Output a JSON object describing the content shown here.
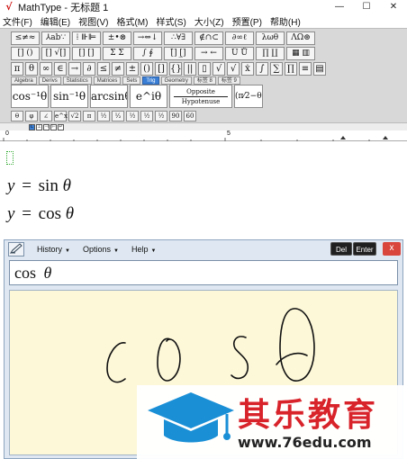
{
  "window": {
    "title": "MathType - 无标题 1",
    "logo_letter": "√",
    "min_glyph": "—",
    "max_glyph": "☐",
    "close_glyph": "✕"
  },
  "menubar": [
    "文件(F)",
    "编辑(E)",
    "视图(V)",
    "格式(M)",
    "样式(S)",
    "大小(Z)",
    "预置(P)",
    "帮助(H)"
  ],
  "toolbar": {
    "row1": [
      "≤≠≈",
      "⅄ab∵",
      "⁞ ⊪⊫",
      "±•⊗",
      "→⇔↓",
      "∴∀∃",
      "∉∩⊂",
      "∂∞ℓ",
      "λωθ",
      "ΛΩ⊛"
    ],
    "row2": [
      "[] ()",
      "[] √[]",
      "[] []",
      "Σ Σ",
      "∫ ∮",
      "[̄] [̲]",
      "→ ←",
      "Ū Ů",
      "∏ ∐",
      "▦ ▥"
    ],
    "row3": [
      "π",
      "θ",
      "∞",
      "∈",
      "→",
      "∂",
      "≤",
      "≠",
      "±",
      "()",
      "[]",
      "{}",
      "||",
      "▯",
      "√",
      "√",
      "ẋ",
      "∫",
      "∑",
      "∏",
      "≡",
      "▤"
    ],
    "tabs": [
      "Algebra",
      "Derivs",
      "Statistics",
      "Matrices",
      "Sets",
      "Trig",
      "Geometry",
      "标签 8",
      "标签 9"
    ],
    "active_tab": "Trig",
    "templates": [
      "cos⁻¹θ",
      "sin⁻¹θ",
      "arcsinθ",
      "e^iθ"
    ],
    "frac_top": "Opposite",
    "frac_bottom": "Hypotenuse",
    "small_row": [
      "θ",
      "φ",
      "∠",
      "e^x",
      "√2",
      "π",
      "½",
      "¹⁄₂",
      "½",
      "½",
      "½",
      "90",
      "60"
    ]
  },
  "ruler": {
    "tabs": [
      "L",
      "⊥",
      "⊣",
      "⊢",
      "↵"
    ],
    "mark_0": "0",
    "mark_5": "5"
  },
  "document": {
    "eq1": {
      "lhs": "y",
      "eq": "=",
      "fn": "sin",
      "var": "θ"
    },
    "eq2": {
      "lhs": "y",
      "eq": "=",
      "fn": "cos",
      "var": "θ"
    }
  },
  "handwriting": {
    "menus": [
      "History",
      "Options",
      "Help"
    ],
    "del_label": "Del",
    "enter_label": "Enter",
    "close_label": "x",
    "preview_fn": "cos",
    "preview_var": "θ"
  },
  "watermark": {
    "name": "其乐教育",
    "url": "www.76edu.com",
    "brand_color": "#d8232a",
    "cap_color": "#1a8fd6"
  }
}
